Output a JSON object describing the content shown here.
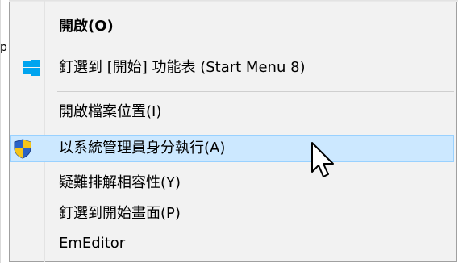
{
  "menu": {
    "items": [
      {
        "label": "開啟(O)",
        "bold": true,
        "icon": ""
      },
      {
        "label": "釘選到 [開始] 功能表 (Start Menu 8)",
        "bold": false,
        "icon": "windows-logo-icon"
      },
      {
        "label": "開啟檔案位置(I)",
        "bold": false,
        "icon": ""
      },
      {
        "label": "以系統管理員身分執行(A)",
        "bold": false,
        "icon": "uac-shield-icon",
        "highlighted": true
      },
      {
        "label": "疑難排解相容性(Y)",
        "bold": false,
        "icon": ""
      },
      {
        "label": "釘選到開始畫面(P)",
        "bold": false,
        "icon": ""
      },
      {
        "label": "EmEditor",
        "bold": false,
        "icon": ""
      }
    ]
  },
  "background": {
    "glyph": "p"
  },
  "colors": {
    "menu_bg": "#f2f2f2",
    "highlight_bg": "#cce8ff",
    "highlight_border": "#99d1ff",
    "windows_blue": "#00a4ef"
  },
  "cursor": {
    "icon": "arrow-cursor-icon"
  }
}
